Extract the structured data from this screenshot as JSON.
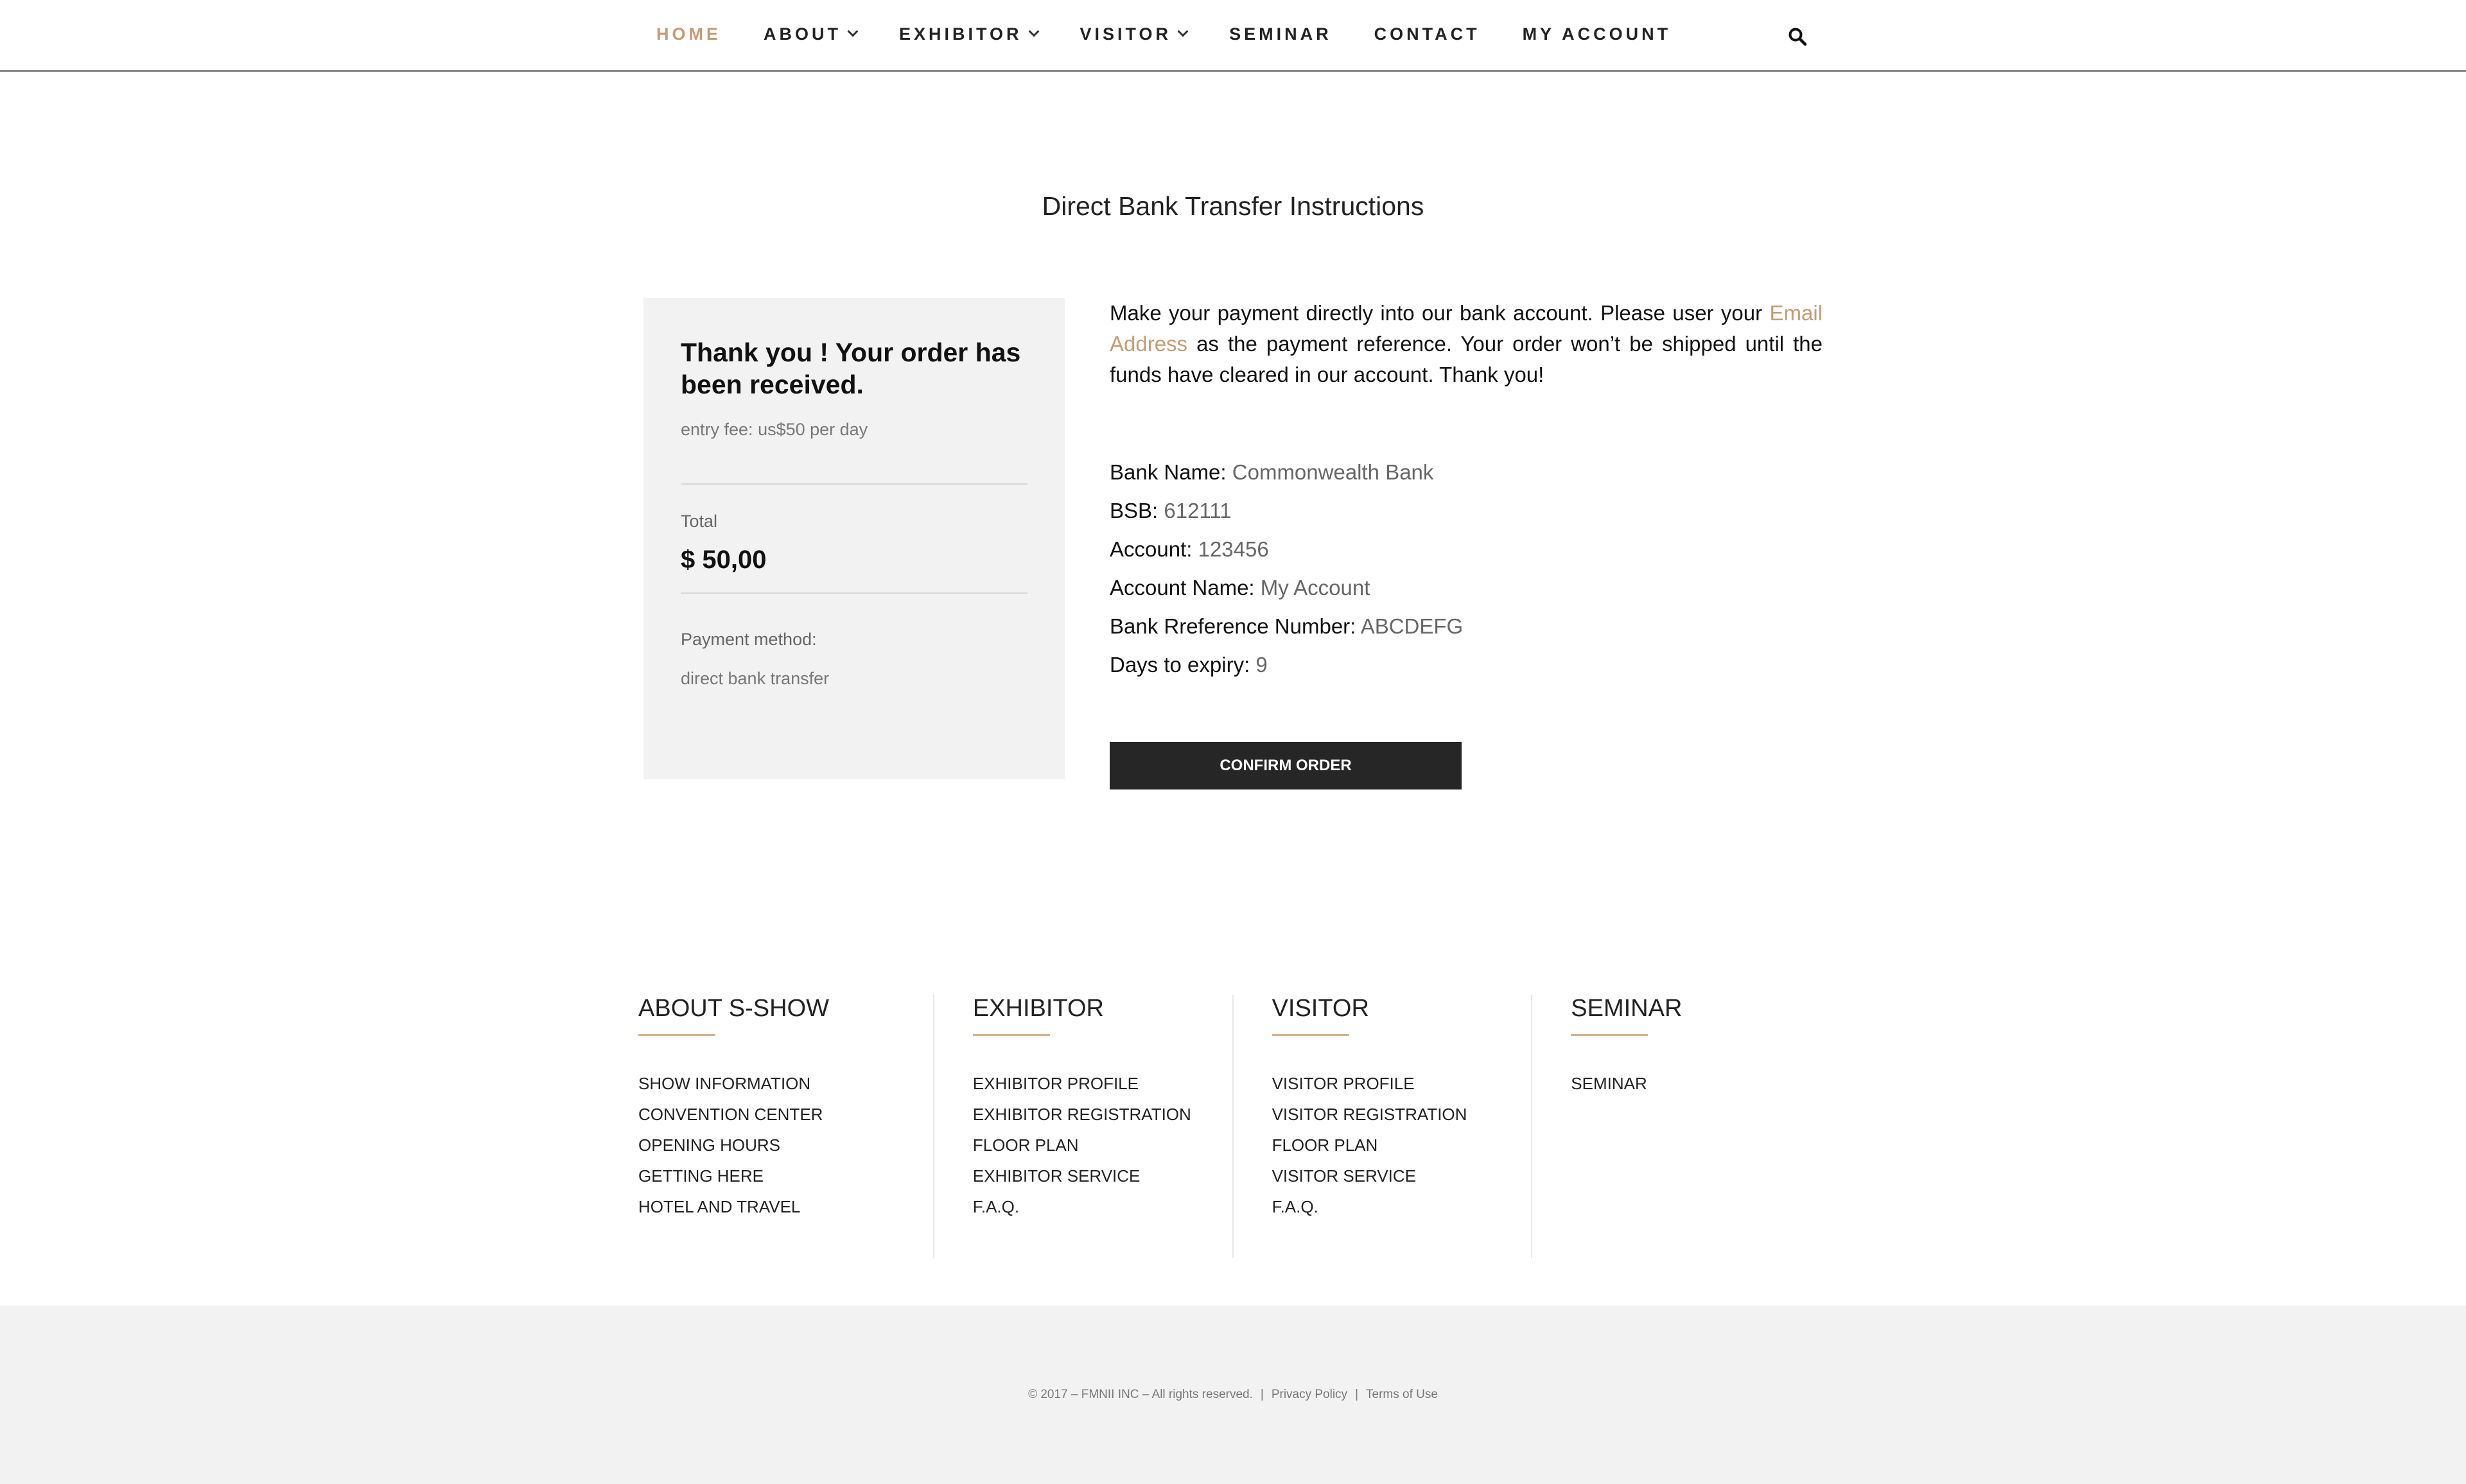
{
  "nav": {
    "items": [
      {
        "label": "HOME",
        "active": true,
        "dropdown": false
      },
      {
        "label": "ABOUT",
        "active": false,
        "dropdown": true
      },
      {
        "label": "EXHIBITOR",
        "active": false,
        "dropdown": true
      },
      {
        "label": "VISITOR",
        "active": false,
        "dropdown": true
      },
      {
        "label": "SEMINAR",
        "active": false,
        "dropdown": false
      },
      {
        "label": "CONTACT",
        "active": false,
        "dropdown": false
      },
      {
        "label": "MY ACCOUNT",
        "active": false,
        "dropdown": false
      }
    ],
    "search_icon": "search-icon"
  },
  "colors": {
    "accent": "#c59b72",
    "button_bg": "#262626",
    "card_bg": "#f2f2f2"
  },
  "page": {
    "title": "Direct Bank Transfer Instructions"
  },
  "order": {
    "heading": "Thank you ! Your order has been received.",
    "entry_fee": "entry fee: us$50 per day",
    "total_label": "Total",
    "total_value": "$ 50,00",
    "payment_method_label": "Payment method:",
    "payment_method_value": "direct bank transfer"
  },
  "instructions": {
    "text_before": "Make your payment directly into our bank account. Please user your ",
    "link_text": "Email Address",
    "text_after": " as the payment reference. Your order won’t be shipped until the funds have cleared in our account. Thank you!"
  },
  "bank": {
    "bank_name_label": "Bank Name:",
    "bank_name": "Commonwealth Bank",
    "bsb_label": "BSB:",
    "bsb": "612111",
    "account_label": "Account:",
    "account": "123456",
    "account_name_label": "Account Name:",
    "account_name": "My Account",
    "reference_label": "Bank Rreference Number:",
    "reference": "ABCDEFG",
    "expiry_label": "Days to expiry:",
    "expiry": "9"
  },
  "confirm_button": "CONFIRM ORDER",
  "footer": {
    "columns": [
      {
        "heading": "ABOUT S-SHOW",
        "links": [
          "SHOW INFORMATION",
          "CONVENTION CENTER",
          "OPENING HOURS",
          "GETTING HERE",
          "HOTEL AND TRAVEL"
        ]
      },
      {
        "heading": "EXHIBITOR",
        "links": [
          "EXHIBITOR PROFILE",
          "EXHIBITOR REGISTRATION",
          "FLOOR PLAN",
          "EXHIBITOR SERVICE",
          "F.A.Q."
        ]
      },
      {
        "heading": "VISITOR",
        "links": [
          "VISITOR PROFILE",
          "VISITOR REGISTRATION",
          "FLOOR PLAN",
          "VISITOR SERVICE",
          "F.A.Q."
        ]
      },
      {
        "heading": "SEMINAR",
        "links": [
          "SEMINAR"
        ]
      }
    ]
  },
  "bottom": {
    "copyright": "© 2017 – FMNII INC – All rights reserved.",
    "privacy": "Privacy Policy",
    "terms": "Terms of Use"
  }
}
